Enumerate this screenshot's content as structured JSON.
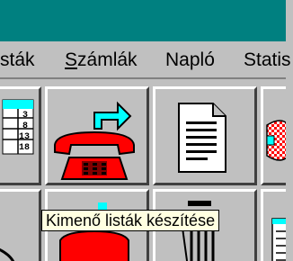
{
  "window": {
    "title": ""
  },
  "menu": {
    "items": [
      {
        "label": "sták",
        "underline": ""
      },
      {
        "label": "Számlák",
        "underline": "S"
      },
      {
        "label": "Napló",
        "underline": ""
      },
      {
        "label": "Statis",
        "underline": ""
      }
    ]
  },
  "toolbar": {
    "buttons": [
      {
        "icon": "calendar-icon"
      },
      {
        "icon": "phone-redirect-icon"
      },
      {
        "icon": "document-icon"
      },
      {
        "icon": "checkered-icon"
      },
      {
        "icon": "partial-icon"
      },
      {
        "icon": "phone-icon"
      },
      {
        "icon": "printer-icon"
      },
      {
        "icon": "table-icon"
      }
    ],
    "tooltip": "Kimenő listák készítése"
  },
  "colors": {
    "titlebar": "#008080",
    "face": "#c0c0c0",
    "phone_red": "#ff0000",
    "arrow_cyan": "#00ffff",
    "calendar_teal": "#00ffff",
    "tooltip_bg": "#ffffe1"
  }
}
